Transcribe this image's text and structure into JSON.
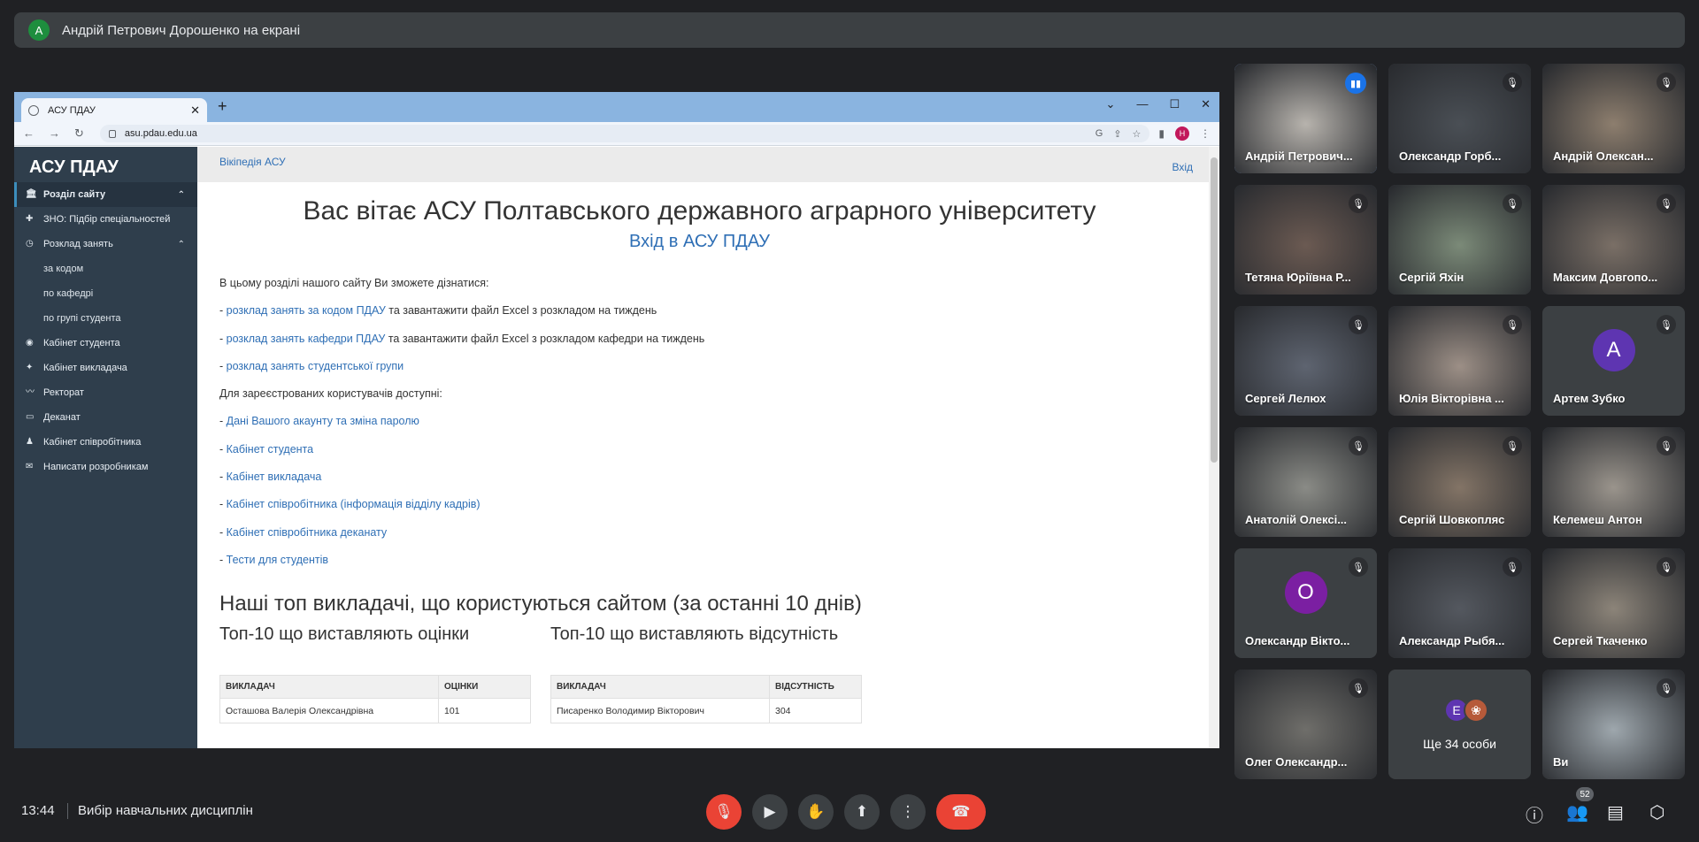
{
  "banner": {
    "avatar": "A",
    "text": "Андрій Петрович Дорошенко на екрані"
  },
  "browser": {
    "tab_title": "АСУ ПДАУ",
    "url": "asu.pdau.edu.ua",
    "profile_letter": "H"
  },
  "site": {
    "logo": "АСУ ПДАУ",
    "sidebar": [
      {
        "label": "Розділ сайту",
        "icon": "bank-icon",
        "type": "active"
      },
      {
        "label": "ЗНО: Підбір спеціальностей",
        "icon": "puzzle-icon",
        "type": "item"
      },
      {
        "label": "Розклад занять",
        "icon": "clock-icon",
        "type": "item-expanded"
      },
      {
        "label": "за кодом",
        "type": "sub"
      },
      {
        "label": "по кафедрі",
        "type": "sub"
      },
      {
        "label": "по групі студента",
        "type": "sub"
      },
      {
        "label": "Кабінет студента",
        "icon": "circle-icon",
        "type": "item"
      },
      {
        "label": "Кабінет викладача",
        "icon": "teacher-icon",
        "type": "item"
      },
      {
        "label": "Ректорат",
        "icon": "wave-icon",
        "type": "item"
      },
      {
        "label": "Деканат",
        "icon": "folder-icon",
        "type": "item"
      },
      {
        "label": "Кабінет співробітника",
        "icon": "user-icon",
        "type": "item"
      },
      {
        "label": "Написати розробникам",
        "icon": "mail-icon",
        "type": "item"
      }
    ],
    "wiki_link": "Вікіпедія АСУ",
    "login_link": "Вхід",
    "heading": "Вас вітає АСУ Полтавського державного аграрного університету",
    "heading_link": "Вхід в АСУ ПДАУ",
    "intro": "В цьому розділі нашого сайту Ви зможете дізнатися:",
    "lines": [
      {
        "link": "розклад занять за кодом ПДАУ",
        "rest": " та завантажити файл Excel з розкладом на тиждень"
      },
      {
        "link": "розклад занять кафедри ПДАУ",
        "rest": " та завантажити файл Excel з розкладом кафедри на тиждень"
      },
      {
        "link": "розклад занять студентської групи",
        "rest": ""
      }
    ],
    "registered": "Для зареєстрованих користувачів доступні:",
    "reg_links": [
      "Дані Вашого акаунту та зміна паролю",
      "Кабінет студента",
      "Кабінет викладача",
      "Кабінет співробітника (інформація відділу кадрів)",
      "Кабінет співробітника деканату",
      "Тести для студентів"
    ],
    "top_heading": "Наші топ викладачі, що користуються сайтом (за останні 10 днів)",
    "top_grades": {
      "title": "Топ-10 що виставляють оцінки",
      "col1": "ВИКЛАДАЧ",
      "col2": "ОЦІНКИ",
      "rows": [
        {
          "name": "Осташова Валерія Олександрівна",
          "value": "101"
        }
      ]
    },
    "top_absence": {
      "title": "Топ-10 що виставляють відсутність",
      "col1": "ВИКЛАДАЧ",
      "col2": "ВІДСУТНІСТЬ",
      "rows": [
        {
          "name": "Писаренко Володимир Вікторович",
          "value": "304"
        }
      ]
    }
  },
  "participants": [
    {
      "name": "Андрій Петрович...",
      "speaking": true,
      "bg": "#b7b3ad"
    },
    {
      "name": "Олександр Горб...",
      "bg": "#4a4f55"
    },
    {
      "name": "Андрій Олексан...",
      "bg": "#8d7e6e"
    },
    {
      "name": "Тетяна Юріївна Р...",
      "bg": "#6b5a52"
    },
    {
      "name": "Сергій Яхін",
      "bg": "#7b8a78"
    },
    {
      "name": "Максим Довгопо...",
      "bg": "#7a6f66"
    },
    {
      "name": "Сергей Лелюх",
      "bg": "#5e6470"
    },
    {
      "name": "Юлія Вікторівна ...",
      "bg": "#9c8f86"
    },
    {
      "name": "Артем Зубко",
      "letter": "A",
      "letter_bg": "#5e35b1"
    },
    {
      "name": "Анатолій Олексі...",
      "bg": "#8a8b86"
    },
    {
      "name": "Сергій Шовкопляс",
      "bg": "#837466"
    },
    {
      "name": "Келемеш Антон",
      "bg": "#9a948c"
    },
    {
      "name": "Олександр Вікто...",
      "letter": "O",
      "letter_bg": "#7b1fa2"
    },
    {
      "name": "Александр Рыбя...",
      "bg": "#54585f"
    },
    {
      "name": "Сергей Ткаченко",
      "bg": "#8c8479"
    },
    {
      "name": "Олег Олександр...",
      "bg": "#6f6e6a"
    },
    {
      "name": "",
      "more": "Ще 34 особи",
      "stack_letter": "E"
    },
    {
      "name": "Ви",
      "bg": "#9ea7ad"
    }
  ],
  "bottom": {
    "time": "13:44",
    "meeting": "Вибір навчальних дисциплін",
    "people_count": "52"
  }
}
